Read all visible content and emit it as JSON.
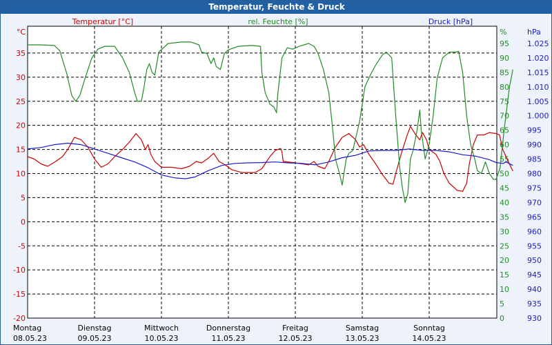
{
  "window": {
    "title": "Temperatur, Feuchte & Druck"
  },
  "colors": {
    "temperature": "#cc0000",
    "humidity": "#228b22",
    "pressure": "#1a1acc",
    "grid": "#000000",
    "title_bg": "#2161a3"
  },
  "chart_data": {
    "type": "line",
    "title": "Temperatur, Feuchte & Druck",
    "grid": true,
    "legend_placement": "top",
    "x_categories": [
      {
        "day": "Montag",
        "date": "08.05.23"
      },
      {
        "day": "Dienstag",
        "date": "09.05.23"
      },
      {
        "day": "Mittwoch",
        "date": "10.05.23"
      },
      {
        "day": "Donnerstag",
        "date": "11.05.23"
      },
      {
        "day": "Freitag",
        "date": "12.05.23"
      },
      {
        "day": "Samstag",
        "date": "13.05.23"
      },
      {
        "day": "Sonntag",
        "date": "14.05.23"
      }
    ],
    "x_range": [
      0,
      7
    ],
    "axes": {
      "temperature": {
        "label": "Temperatur [°C]",
        "unit": "°C",
        "range": [
          -20,
          40
        ],
        "ticks": [
          "35",
          "30",
          "25",
          "20",
          "15",
          "10",
          "5",
          "0",
          "-5",
          "-10",
          "-15",
          "-20"
        ]
      },
      "humidity": {
        "label": "rel. Feuchte [%]",
        "unit": "%",
        "range": [
          0,
          100
        ],
        "ticks": [
          "95",
          "90",
          "85",
          "80",
          "75",
          "70",
          "65",
          "60",
          "55",
          "50",
          "45",
          "40",
          "35",
          "30",
          "25",
          "20",
          "15",
          "10",
          "5",
          "0"
        ]
      },
      "pressure": {
        "label": "Druck [hPa]",
        "unit": "hPa",
        "range": [
          930,
          1030
        ],
        "ticks": [
          "1.025",
          "1.020",
          "1.015",
          "1.010",
          "1.005",
          "1.000",
          "995",
          "990",
          "985",
          "980",
          "975",
          "970",
          "965",
          "960",
          "955",
          "950",
          "945",
          "940",
          "935",
          "930"
        ]
      }
    },
    "series": [
      {
        "name": "Temperatur [°C]",
        "axis": "temperature",
        "points": [
          [
            0,
            13.5
          ],
          [
            0.1,
            13
          ],
          [
            0.2,
            12
          ],
          [
            0.3,
            11.5
          ],
          [
            0.42,
            12.5
          ],
          [
            0.52,
            13.5
          ],
          [
            0.6,
            15
          ],
          [
            0.7,
            17.5
          ],
          [
            0.8,
            17
          ],
          [
            0.9,
            15.5
          ],
          [
            1.0,
            13
          ],
          [
            1.1,
            11.3
          ],
          [
            1.2,
            12
          ],
          [
            1.3,
            13.5
          ],
          [
            1.42,
            15
          ],
          [
            1.52,
            16.5
          ],
          [
            1.62,
            18.3
          ],
          [
            1.7,
            17
          ],
          [
            1.76,
            15
          ],
          [
            1.8,
            16
          ],
          [
            1.84,
            14
          ],
          [
            1.9,
            12.5
          ],
          [
            2.0,
            11.3
          ],
          [
            2.15,
            11.3
          ],
          [
            2.3,
            11
          ],
          [
            2.42,
            11.5
          ],
          [
            2.52,
            12.5
          ],
          [
            2.6,
            12.2
          ],
          [
            2.7,
            13.2
          ],
          [
            2.78,
            14.2
          ],
          [
            2.86,
            12.5
          ],
          [
            2.95,
            11.8
          ],
          [
            3.05,
            10.8
          ],
          [
            3.2,
            10.2
          ],
          [
            3.4,
            10.2
          ],
          [
            3.5,
            11
          ],
          [
            3.62,
            13.5
          ],
          [
            3.7,
            14.8
          ],
          [
            3.78,
            15.2
          ],
          [
            3.8,
            14.5
          ],
          [
            3.82,
            12.5
          ],
          [
            3.95,
            12.3
          ],
          [
            4.1,
            12
          ],
          [
            4.2,
            11.8
          ],
          [
            4.28,
            12.5
          ],
          [
            4.34,
            11.5
          ],
          [
            4.44,
            11
          ],
          [
            4.5,
            12.5
          ],
          [
            4.6,
            15.5
          ],
          [
            4.7,
            17.5
          ],
          [
            4.8,
            18.3
          ],
          [
            4.9,
            17
          ],
          [
            4.96,
            15.5
          ],
          [
            5.02,
            16
          ],
          [
            5.1,
            14
          ],
          [
            5.2,
            12
          ],
          [
            5.3,
            9.8
          ],
          [
            5.4,
            8
          ],
          [
            5.46,
            7.8
          ],
          [
            5.5,
            10
          ],
          [
            5.58,
            14
          ],
          [
            5.66,
            17.5
          ],
          [
            5.72,
            19.8
          ],
          [
            5.8,
            18
          ],
          [
            5.86,
            17
          ],
          [
            5.9,
            18.5
          ],
          [
            5.96,
            17
          ],
          [
            6.0,
            15
          ],
          [
            6.1,
            14
          ],
          [
            6.16,
            12.5
          ],
          [
            6.22,
            10
          ],
          [
            6.3,
            8
          ],
          [
            6.42,
            6.5
          ],
          [
            6.5,
            6.3
          ],
          [
            6.56,
            8
          ],
          [
            6.6,
            12
          ],
          [
            6.66,
            16
          ],
          [
            6.72,
            18
          ],
          [
            6.82,
            18
          ],
          [
            6.9,
            18.5
          ],
          [
            7.0,
            18.3
          ],
          [
            7.05,
            18
          ],
          [
            7.1,
            15
          ],
          [
            7.18,
            12.5
          ],
          [
            7.25,
            10.5
          ]
        ]
      },
      {
        "name": "rel. Feuchte [%]",
        "axis": "humidity",
        "points": [
          [
            0,
            94.5
          ],
          [
            0.2,
            94.5
          ],
          [
            0.4,
            94.3
          ],
          [
            0.48,
            92.5
          ],
          [
            0.58,
            85
          ],
          [
            0.66,
            77
          ],
          [
            0.72,
            75
          ],
          [
            0.78,
            77
          ],
          [
            0.86,
            83
          ],
          [
            0.96,
            90
          ],
          [
            1.05,
            93
          ],
          [
            1.15,
            94
          ],
          [
            1.3,
            94
          ],
          [
            1.42,
            90
          ],
          [
            1.52,
            85
          ],
          [
            1.6,
            78
          ],
          [
            1.64,
            75
          ],
          [
            1.7,
            75
          ],
          [
            1.74,
            80
          ],
          [
            1.78,
            86
          ],
          [
            1.82,
            88
          ],
          [
            1.86,
            85
          ],
          [
            1.9,
            84
          ],
          [
            1.96,
            92
          ],
          [
            2.1,
            95
          ],
          [
            2.3,
            95.5
          ],
          [
            2.44,
            95.5
          ],
          [
            2.56,
            94.5
          ],
          [
            2.6,
            92
          ],
          [
            2.68,
            91.5
          ],
          [
            2.74,
            88
          ],
          [
            2.78,
            90
          ],
          [
            2.82,
            87
          ],
          [
            2.88,
            86
          ],
          [
            2.94,
            91.5
          ],
          [
            3.0,
            92.8
          ],
          [
            3.15,
            94
          ],
          [
            3.35,
            94.3
          ],
          [
            3.48,
            94
          ],
          [
            3.5,
            85
          ],
          [
            3.55,
            78
          ],
          [
            3.62,
            74
          ],
          [
            3.68,
            73
          ],
          [
            3.72,
            71
          ],
          [
            3.74,
            78
          ],
          [
            3.8,
            90
          ],
          [
            3.88,
            93.5
          ],
          [
            3.96,
            93
          ],
          [
            4.06,
            94
          ],
          [
            4.2,
            95
          ],
          [
            4.28,
            94
          ],
          [
            4.34,
            91.5
          ],
          [
            4.42,
            86
          ],
          [
            4.5,
            78
          ],
          [
            4.56,
            65
          ],
          [
            4.6,
            55
          ],
          [
            4.66,
            50
          ],
          [
            4.7,
            46
          ],
          [
            4.76,
            55
          ],
          [
            4.8,
            57
          ],
          [
            4.86,
            58
          ],
          [
            4.96,
            68
          ],
          [
            5.04,
            80
          ],
          [
            5.12,
            84
          ],
          [
            5.2,
            87.5
          ],
          [
            5.3,
            91
          ],
          [
            5.36,
            92
          ],
          [
            5.44,
            90
          ],
          [
            5.5,
            70
          ],
          [
            5.56,
            52
          ],
          [
            5.6,
            45
          ],
          [
            5.64,
            40
          ],
          [
            5.68,
            43
          ],
          [
            5.72,
            55
          ],
          [
            5.76,
            58
          ],
          [
            5.82,
            65
          ],
          [
            5.86,
            72
          ],
          [
            5.88,
            65
          ],
          [
            5.94,
            55
          ],
          [
            6.0,
            60
          ],
          [
            6.06,
            70
          ],
          [
            6.12,
            83
          ],
          [
            6.2,
            90
          ],
          [
            6.3,
            92
          ],
          [
            6.4,
            92
          ],
          [
            6.44,
            92.3
          ],
          [
            6.5,
            85
          ],
          [
            6.56,
            70
          ],
          [
            6.62,
            60
          ],
          [
            6.68,
            55
          ],
          [
            6.72,
            51
          ],
          [
            6.78,
            50
          ],
          [
            6.84,
            54
          ],
          [
            6.9,
            50
          ],
          [
            6.96,
            48
          ],
          [
            7.0,
            48
          ],
          [
            7.06,
            52
          ],
          [
            7.12,
            65
          ],
          [
            7.2,
            80
          ],
          [
            7.25,
            86
          ]
        ]
      },
      {
        "name": "Druck [hPa]",
        "axis": "pressure",
        "points": [
          [
            0,
            988.5
          ],
          [
            0.2,
            989
          ],
          [
            0.4,
            990
          ],
          [
            0.6,
            990.5
          ],
          [
            0.8,
            990
          ],
          [
            1.0,
            988.5
          ],
          [
            1.2,
            987
          ],
          [
            1.4,
            985.5
          ],
          [
            1.6,
            984
          ],
          [
            1.8,
            982
          ],
          [
            2.0,
            979.5
          ],
          [
            2.2,
            978.5
          ],
          [
            2.36,
            978.2
          ],
          [
            2.5,
            978.8
          ],
          [
            2.7,
            981
          ],
          [
            2.9,
            982.8
          ],
          [
            3.1,
            983.5
          ],
          [
            3.3,
            983.7
          ],
          [
            3.5,
            983.8
          ],
          [
            3.7,
            984
          ],
          [
            3.9,
            983.7
          ],
          [
            4.1,
            983.5
          ],
          [
            4.3,
            983
          ],
          [
            4.5,
            984
          ],
          [
            4.7,
            985.5
          ],
          [
            4.9,
            986.3
          ],
          [
            5.1,
            987.8
          ],
          [
            5.3,
            988
          ],
          [
            5.5,
            988
          ],
          [
            5.7,
            988.5
          ],
          [
            5.9,
            988
          ],
          [
            6.1,
            988
          ],
          [
            6.3,
            987.5
          ],
          [
            6.5,
            986.5
          ],
          [
            6.7,
            986
          ],
          [
            6.9,
            984.8
          ],
          [
            7.0,
            983.8
          ],
          [
            7.1,
            983.5
          ],
          [
            7.15,
            984
          ],
          [
            7.25,
            982.8
          ]
        ]
      }
    ]
  }
}
